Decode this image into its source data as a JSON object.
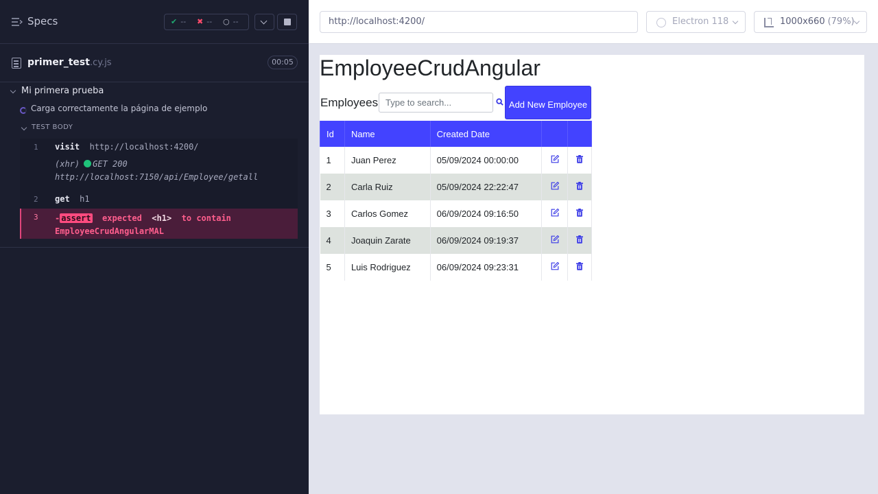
{
  "runner": {
    "specs_label": "Specs",
    "stats": {
      "passed": "--",
      "failed": "--",
      "pending": "--"
    },
    "spec": {
      "name": "primer_test",
      "ext": ".cy.js",
      "duration": "00:05"
    },
    "suite_title": "Mi primera prueba",
    "test_title": "Carga correctamente la página de ejemplo",
    "body_label": "TEST BODY",
    "commands": [
      {
        "num": "1",
        "name": "visit",
        "arg": "http://localhost:4200/"
      },
      {
        "prefix": "(xhr)",
        "status": "GET 200",
        "url": "http://localhost:7150/api/Employee/getall"
      },
      {
        "num": "2",
        "name": "get",
        "arg": "h1"
      },
      {
        "num": "3",
        "dash": "-",
        "name": "assert",
        "text1": "expected",
        "tag": "<h1>",
        "text2": "to contain",
        "value": "EmployeeCrudAngularMAL"
      }
    ]
  },
  "browser": {
    "url": "http://localhost:4200/",
    "browser_name": "Electron 118",
    "viewport_size": "1000x660",
    "zoom": "(79%)"
  },
  "app": {
    "title": "EmployeeCrudAngular",
    "employees_label": "Employees:",
    "search_placeholder": "Type to search...",
    "add_button_label": "Add New Employee",
    "columns": [
      "Id",
      "Name",
      "Created Date"
    ],
    "rows": [
      {
        "id": "1",
        "name": "Juan Perez",
        "date": "05/09/2024 00:00:00"
      },
      {
        "id": "2",
        "name": "Carla Ruiz",
        "date": "05/09/2024 22:22:47"
      },
      {
        "id": "3",
        "name": "Carlos Gomez",
        "date": "06/09/2024 09:16:50"
      },
      {
        "id": "4",
        "name": "Joaquin Zarate",
        "date": "06/09/2024 09:19:37"
      },
      {
        "id": "5",
        "name": "Luis Rodriguez",
        "date": "06/09/2024 09:23:31"
      }
    ]
  },
  "colors": {
    "runner_bg": "#1b1e2e",
    "accent_blue": "#4343ff",
    "fail_pink": "#ff4b80",
    "pass_green": "#1fa971",
    "row_alt": "#dde2de"
  }
}
